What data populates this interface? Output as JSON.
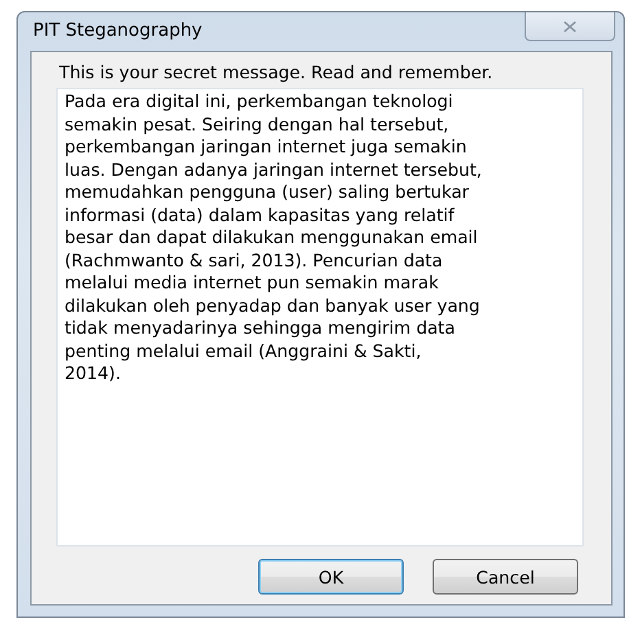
{
  "window": {
    "title": "PIT Steganography"
  },
  "prompt": "This is your secret message. Read and remember.",
  "message_lines": [
    "Pada era digital ini, perkembangan teknologi",
    "semakin pesat. Seiring dengan hal tersebut,",
    "perkembangan jaringan internet juga semakin",
    "luas. Dengan adanya jaringan internet tersebut,",
    "memudahkan pengguna (user) saling bertukar",
    "informasi (data) dalam kapasitas yang relatif",
    "besar dan dapat dilakukan menggunakan email",
    "(Rachmwanto & sari, 2013). Pencurian data",
    "melalui media internet pun semakin marak",
    "dilakukan oleh penyadap dan banyak user yang",
    "tidak menyadarinya sehingga mengirim data",
    "penting melalui email (Anggraini & Sakti,",
    "2014)."
  ],
  "buttons": [
    {
      "label": "OK",
      "default": true
    },
    {
      "label": "Cancel",
      "default": false
    }
  ]
}
